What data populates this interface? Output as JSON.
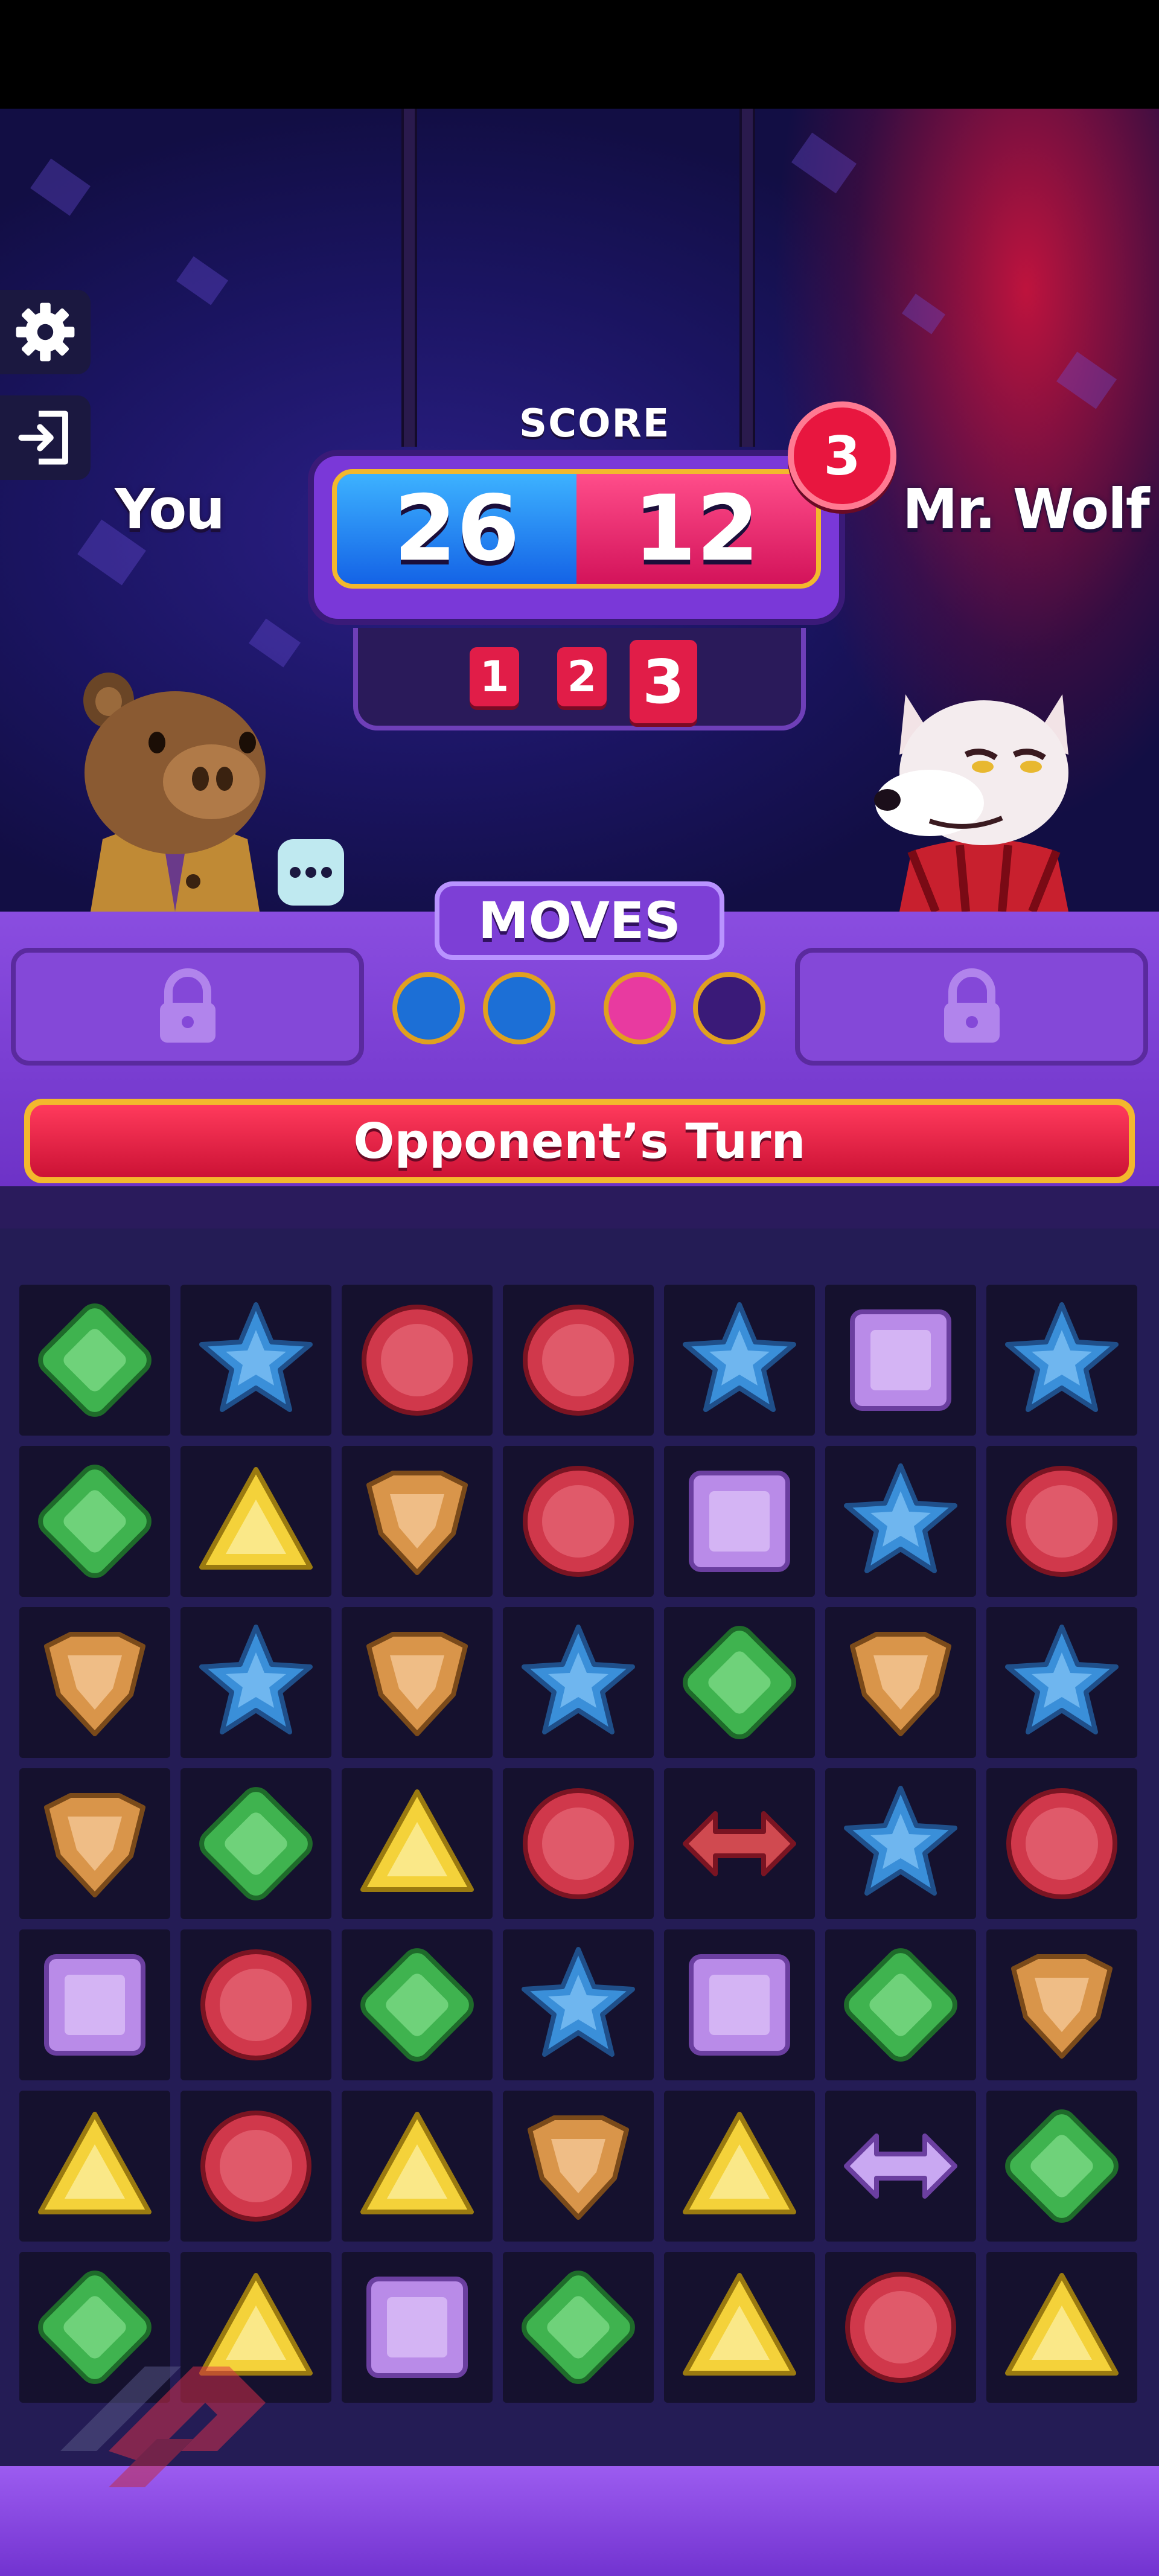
{
  "side_buttons": [
    {
      "name": "settings-gear-button",
      "icon": "gear-icon"
    },
    {
      "name": "exit-button",
      "icon": "exit-icon"
    }
  ],
  "players": {
    "you": "You",
    "opponent": "Mr. Wolf"
  },
  "score": {
    "title": "SCORE",
    "you": "26",
    "opponent": "12",
    "round_badge": "3",
    "rounds": [
      "1",
      "2",
      "3"
    ],
    "current_round": 3
  },
  "moves": {
    "title": "MOVES",
    "dots": [
      "blue",
      "blue",
      "pink",
      "empty"
    ]
  },
  "turn_banner": "Opponent’s Turn",
  "colors": {
    "green": "#3fb34f",
    "blue": "#3a8fd9",
    "red": "#d0384b",
    "purple": "#b98be8",
    "yellow": "#f4d23a",
    "orange": "#d9954a",
    "accent": "#f3b82d",
    "panel": "#7d3fd6"
  },
  "board": {
    "rows": [
      [
        "green-gem",
        "blue-star",
        "red-coin",
        "red-coin",
        "blue-star",
        "purple-square",
        "blue-star"
      ],
      [
        "green-gem",
        "yellow-triangle",
        "orange-shield",
        "red-coin",
        "purple-square",
        "blue-star",
        "red-coin"
      ],
      [
        "orange-shield",
        "blue-star",
        "orange-shield",
        "blue-star",
        "green-gem",
        "orange-shield",
        "blue-star"
      ],
      [
        "orange-shield",
        "green-gem",
        "yellow-triangle",
        "red-coin",
        "red-arrow",
        "blue-star",
        "red-coin"
      ],
      [
        "purple-square",
        "red-coin",
        "green-gem",
        "blue-star",
        "purple-square",
        "green-gem",
        "orange-shield"
      ],
      [
        "yellow-triangle",
        "red-coin",
        "yellow-triangle",
        "orange-shield",
        "yellow-triangle",
        "purple-arrow",
        "green-gem"
      ],
      [
        "green-gem",
        "yellow-triangle",
        "purple-square",
        "green-gem",
        "yellow-triangle",
        "red-coin",
        "yellow-triangle"
      ]
    ]
  }
}
